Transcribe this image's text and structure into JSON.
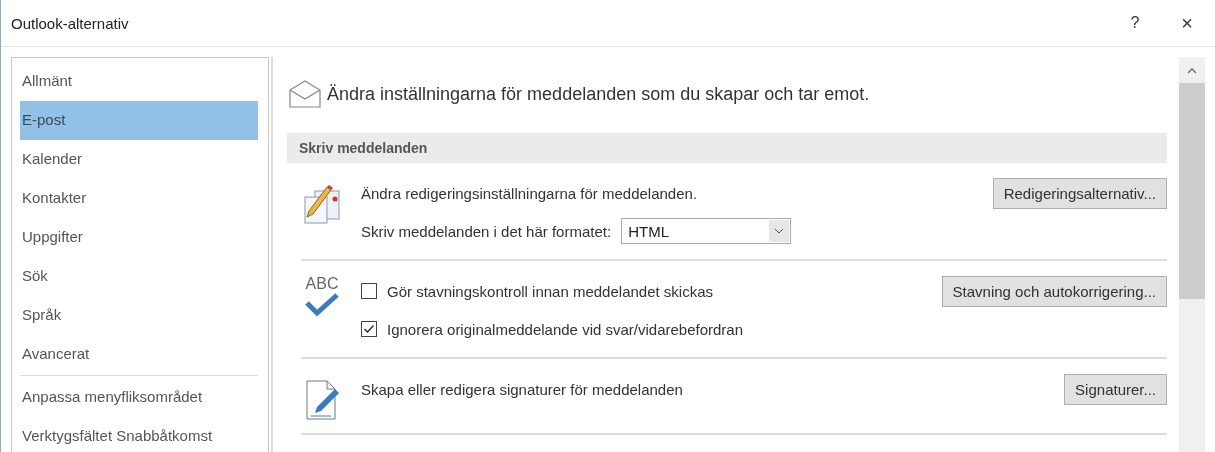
{
  "window": {
    "title": "Outlook-alternativ",
    "help": "?",
    "close": "×"
  },
  "sidebar": {
    "items": [
      {
        "label": "Allmänt",
        "selected": false
      },
      {
        "label": "E-post",
        "selected": true
      },
      {
        "label": "Kalender",
        "selected": false
      },
      {
        "label": "Kontakter",
        "selected": false
      },
      {
        "label": "Uppgifter",
        "selected": false
      },
      {
        "label": "Sök",
        "selected": false
      },
      {
        "label": "Språk",
        "selected": false
      },
      {
        "label": "Avancerat",
        "selected": false
      }
    ],
    "extra_items": [
      {
        "label": "Anpassa menyfliksområdet",
        "selected": false
      },
      {
        "label": "Verktygsfältet Snabbåtkomst",
        "selected": false
      }
    ]
  },
  "content": {
    "heading": "Ändra inställningarna för meddelanden som du skapar och tar emot.",
    "section_title": "Skriv meddelanden",
    "groups": [
      {
        "kind": "editing",
        "text": "Ändra redigeringsinställningarna för meddelanden.",
        "format_label": "Skriv meddelanden i det här formatet:",
        "format_value": "HTML",
        "button": "Redigeringsalternativ..."
      },
      {
        "kind": "proofing",
        "icon_text": "ABC",
        "checkboxes": [
          {
            "label": "Gör stavningskontroll innan meddelandet skickas",
            "checked": false
          },
          {
            "label": "Ignorera originalmeddelande vid svar/vidarebefordran",
            "checked": true
          }
        ],
        "button": "Stavning och autokorrigering..."
      },
      {
        "kind": "signature",
        "text": "Skapa eller redigera signaturer för meddelanden",
        "button": "Signaturer..."
      }
    ]
  }
}
